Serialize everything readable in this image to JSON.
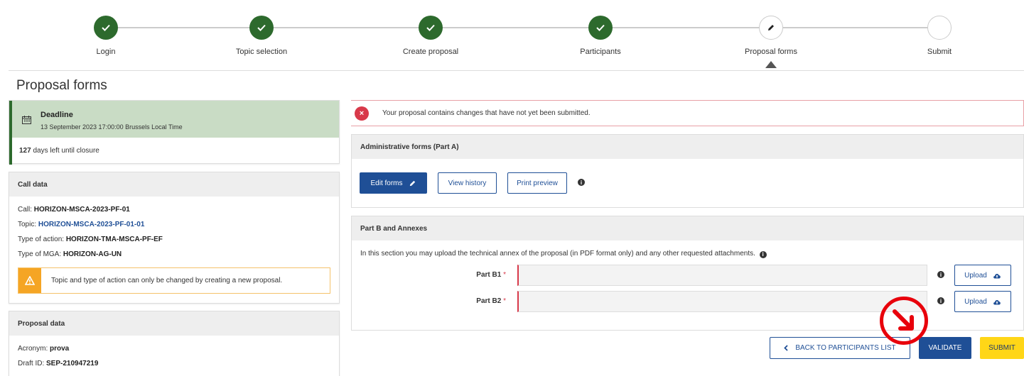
{
  "stepper": {
    "steps": [
      {
        "label": "Login",
        "state": "done"
      },
      {
        "label": "Topic selection",
        "state": "done"
      },
      {
        "label": "Create proposal",
        "state": "done"
      },
      {
        "label": "Participants",
        "state": "done"
      },
      {
        "label": "Proposal forms",
        "state": "current"
      },
      {
        "label": "Submit",
        "state": "todo"
      }
    ]
  },
  "page_title": "Proposal forms",
  "deadline": {
    "title": "Deadline",
    "date": "13 September 2023 17:00:00 Brussels Local Time",
    "days_count": "127",
    "days_text": " days left until closure"
  },
  "call_data": {
    "title": "Call data",
    "call_label": "Call: ",
    "call_value": "HORIZON-MSCA-2023-PF-01",
    "topic_label": "Topic: ",
    "topic_value": "HORIZON-MSCA-2023-PF-01-01",
    "action_label": "Type of action: ",
    "action_value": "HORIZON-TMA-MSCA-PF-EF",
    "mga_label": "Type of MGA: ",
    "mga_value": "HORIZON-AG-UN",
    "warning": "Topic and type of action can only be changed by creating a new proposal."
  },
  "proposal_data": {
    "title": "Proposal data",
    "acronym_label": "Acronym: ",
    "acronym_value": "prova",
    "draft_label": "Draft ID: ",
    "draft_value": "SEP-210947219"
  },
  "alert": {
    "text": "Your proposal contains changes that have not yet been submitted."
  },
  "part_a": {
    "title": "Administrative forms (Part A)",
    "edit_label": "Edit forms",
    "history_label": "View history",
    "preview_label": "Print preview"
  },
  "part_b": {
    "title": "Part B and Annexes",
    "intro": "In this section you may upload the technical annex of the proposal (in PDF format only) and any other requested attachments.",
    "b1_label": "Part B1",
    "b2_label": "Part B2",
    "required_mark": "*",
    "upload_label": "Upload"
  },
  "actions": {
    "back_label": "BACK TO PARTICIPANTS LIST",
    "validate_label": "VALIDATE",
    "submit_label": "SUBMIT"
  },
  "colors": {
    "primary": "#1f4f96",
    "done": "#2d6a2d",
    "deadline_bg": "#c9dcc5",
    "alert": "#d8394a",
    "warning": "#f5a524",
    "submit": "#ffd617",
    "annotation": "#e8000b"
  },
  "icons": {
    "done_step": "check-icon",
    "current_step": "pencil-icon",
    "deadline": "calendar-icon",
    "warning": "warning-triangle-icon",
    "alert": "close-circle-icon",
    "edit": "pencil-icon",
    "info": "info-icon",
    "upload": "cloud-upload-icon",
    "back": "chevron-left-icon",
    "annotation": "arrow-down-right-icon"
  }
}
